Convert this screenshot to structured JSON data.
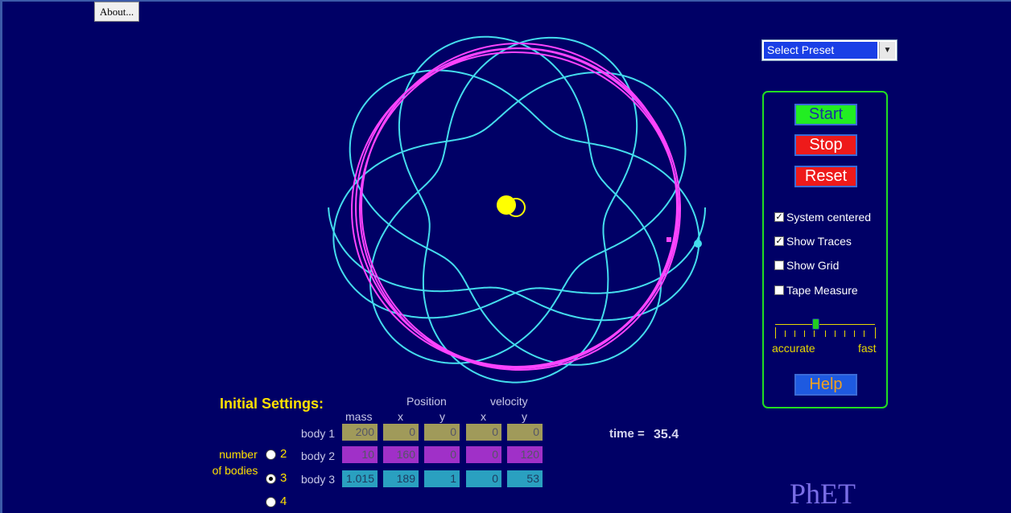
{
  "about": {
    "label": "About..."
  },
  "preset": {
    "selected": "Select Preset"
  },
  "controls": {
    "start": "Start",
    "stop": "Stop",
    "reset": "Reset",
    "help": "Help",
    "checkboxes": [
      {
        "label": "System centered",
        "checked": true
      },
      {
        "label": "Show Traces",
        "checked": true
      },
      {
        "label": "Show Grid",
        "checked": false
      },
      {
        "label": "Tape Measure",
        "checked": false
      }
    ],
    "slider": {
      "left_label": "accurate",
      "right_label": "fast",
      "level": 0.4
    }
  },
  "settings": {
    "title": "Initial Settings:",
    "group_position": "Position",
    "group_velocity": "velocity",
    "columns": [
      "mass",
      "x",
      "y",
      "x",
      "y"
    ],
    "bodies": [
      {
        "label": "body 1",
        "values": [
          "200",
          "0",
          "0",
          "0",
          "0"
        ]
      },
      {
        "label": "body 2",
        "values": [
          "10",
          "160",
          "0",
          "0",
          "120"
        ]
      },
      {
        "label": "body 3",
        "values": [
          "1.015",
          "189",
          "1",
          "0",
          "53"
        ]
      }
    ],
    "number_label_1": "number",
    "number_label_2": "of bodies",
    "options": [
      "2",
      "3",
      "4"
    ],
    "selected_option": "3"
  },
  "time": {
    "label": "time =",
    "value": "35.4"
  },
  "logo": "PhET",
  "colors": {
    "background": "#000066",
    "body1": "#ffff00",
    "body2": "#ff44ff",
    "body3": "#44ddee",
    "panel_border": "#22dd22"
  }
}
